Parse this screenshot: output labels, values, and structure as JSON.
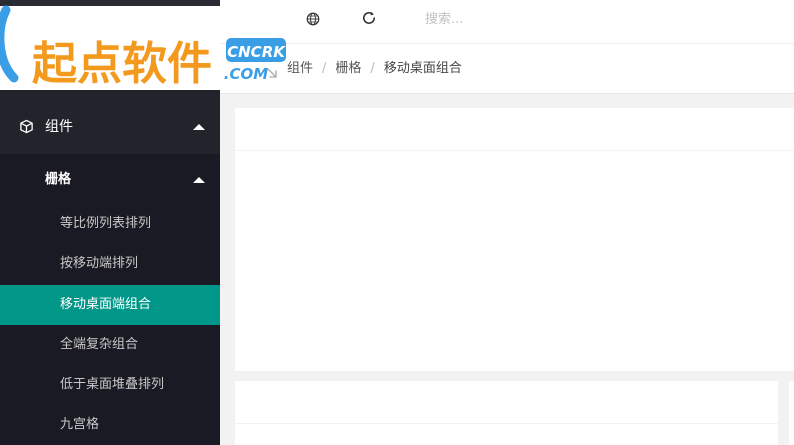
{
  "brand": {
    "logo_text": "起点软件",
    "badge_line1": "CNCRK",
    "badge_line2": ".COM",
    "colors": {
      "orange": "#f39a1e",
      "blue": "#3a9ee6",
      "teal": "#009688",
      "sidebar_bg": "#191a23"
    }
  },
  "header": {
    "icons": [
      "globe-icon",
      "refresh-icon"
    ],
    "search_placeholder": "搜索..."
  },
  "breadcrumb": {
    "items": [
      "组件",
      "栅格",
      "移动桌面组合"
    ],
    "separator": "/"
  },
  "sidebar": {
    "group": {
      "label": "组件",
      "icon": "cube-icon",
      "expanded": true
    },
    "sub": {
      "label": "栅格",
      "expanded": true
    },
    "items": [
      {
        "label": "等比例列表排列",
        "active": false
      },
      {
        "label": "按移动端排列",
        "active": false
      },
      {
        "label": "移动桌面端组合",
        "active": true
      },
      {
        "label": "全端复杂组合",
        "active": false
      },
      {
        "label": "低于桌面堆叠排列",
        "active": false
      },
      {
        "label": "九宫格",
        "active": false
      }
    ]
  }
}
